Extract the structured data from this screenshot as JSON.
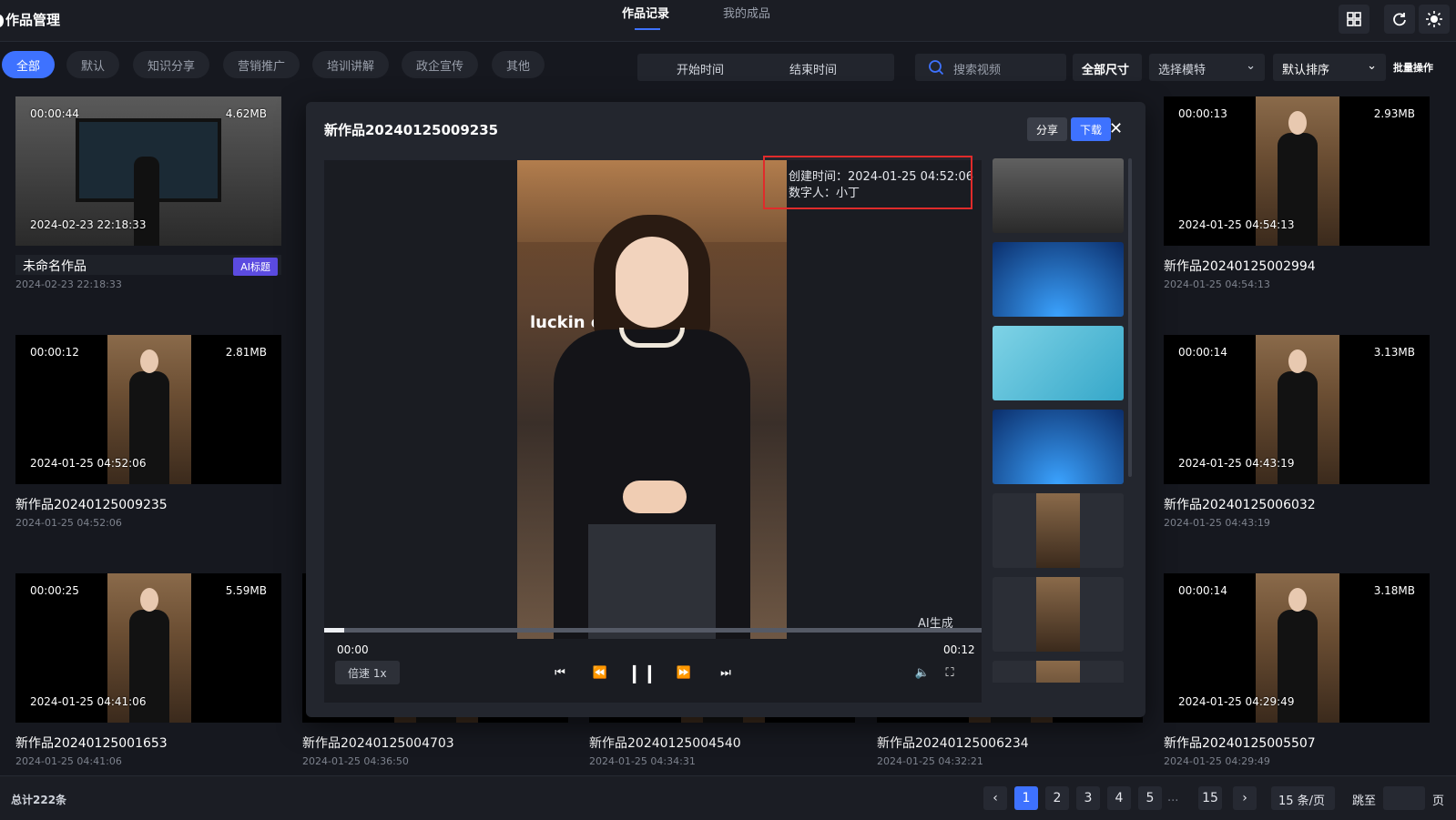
{
  "app": {
    "title": "作品管理"
  },
  "tabs": [
    {
      "label": "作品记录",
      "active": true
    },
    {
      "label": "我的成品",
      "active": false
    }
  ],
  "filters": {
    "chips": [
      "全部",
      "默认",
      "知识分享",
      "营销推广",
      "培训讲解",
      "政企宣传",
      "其他"
    ],
    "active_chip": "全部",
    "start_time": "开始时间",
    "end_time": "结束时间",
    "search_placeholder": "搜索视频",
    "size": "全部尺寸",
    "model": "选择模特",
    "sort": "默认排序",
    "batch": "批量操作"
  },
  "cards": [
    {
      "duration": "00:00:44",
      "size": "4.62MB",
      "created": "2024-02-23 22:18:33",
      "title": "未命名作品",
      "date": "2024-02-23 22:18:33",
      "badge": "AI标题",
      "thumb": "studio-man"
    },
    {
      "duration": "00:00:13",
      "size": "2.93MB",
      "created": "2024-01-25 04:54:13",
      "title": "新作品20240125002994",
      "date": "2024-01-25 04:54:13",
      "thumb": "woman"
    },
    {
      "duration": "00:00:12",
      "size": "2.81MB",
      "created": "2024-01-25 04:52:06",
      "title": "新作品20240125009235",
      "date": "2024-01-25 04:52:06",
      "thumb": "woman"
    },
    {
      "duration": "00:00:14",
      "size": "3.13MB",
      "created": "2024-01-25 04:43:19",
      "title": "新作品20240125006032",
      "date": "2024-01-25 04:43:19",
      "thumb": "woman"
    },
    {
      "duration": "00:00:25",
      "size": "5.59MB",
      "created": "2024-01-25 04:41:06",
      "title": "新作品20240125001653",
      "date": "2024-01-25 04:41:06",
      "thumb": "woman"
    },
    {
      "title": "新作品20240125004703",
      "date": "2024-01-25 04:36:50"
    },
    {
      "title": "新作品20240125004540",
      "date": "2024-01-25 04:34:31"
    },
    {
      "title": "新作品20240125006234",
      "date": "2024-01-25 04:32:21"
    },
    {
      "duration": "00:00:14",
      "size": "3.18MB",
      "created": "2024-01-25 04:29:49",
      "title": "新作品20240125005507",
      "date": "2024-01-25 04:29:49",
      "thumb": "woman"
    }
  ],
  "modal": {
    "title": "新作品20240125009235",
    "share": "分享",
    "download": "下载",
    "info_created": "创建时间：2024-01-25 04:52:06",
    "info_person": "数字人：小丁",
    "logo_text": "luckin cof",
    "ai_label": "AI生成",
    "time_current": "00:00",
    "time_total": "00:12",
    "speed": "倍速 1x",
    "progress": 0.03,
    "thumbnails": [
      "studio-man",
      "globe-woman",
      "cyan-woman",
      "globe-woman",
      "woman-cafe",
      "woman-cafe",
      "woman-cafe"
    ]
  },
  "footer": {
    "total": "总计222条",
    "pages": [
      "1",
      "2",
      "3",
      "4",
      "5",
      "15"
    ],
    "ellipsis": "...",
    "current_page": "1",
    "per_page": "15 条/页",
    "jump_label": "跳至",
    "page_suffix": "页"
  },
  "colors": {
    "accent": "#3e72ff",
    "highlight": "#e02b2b",
    "badge": "#5b4be0"
  }
}
